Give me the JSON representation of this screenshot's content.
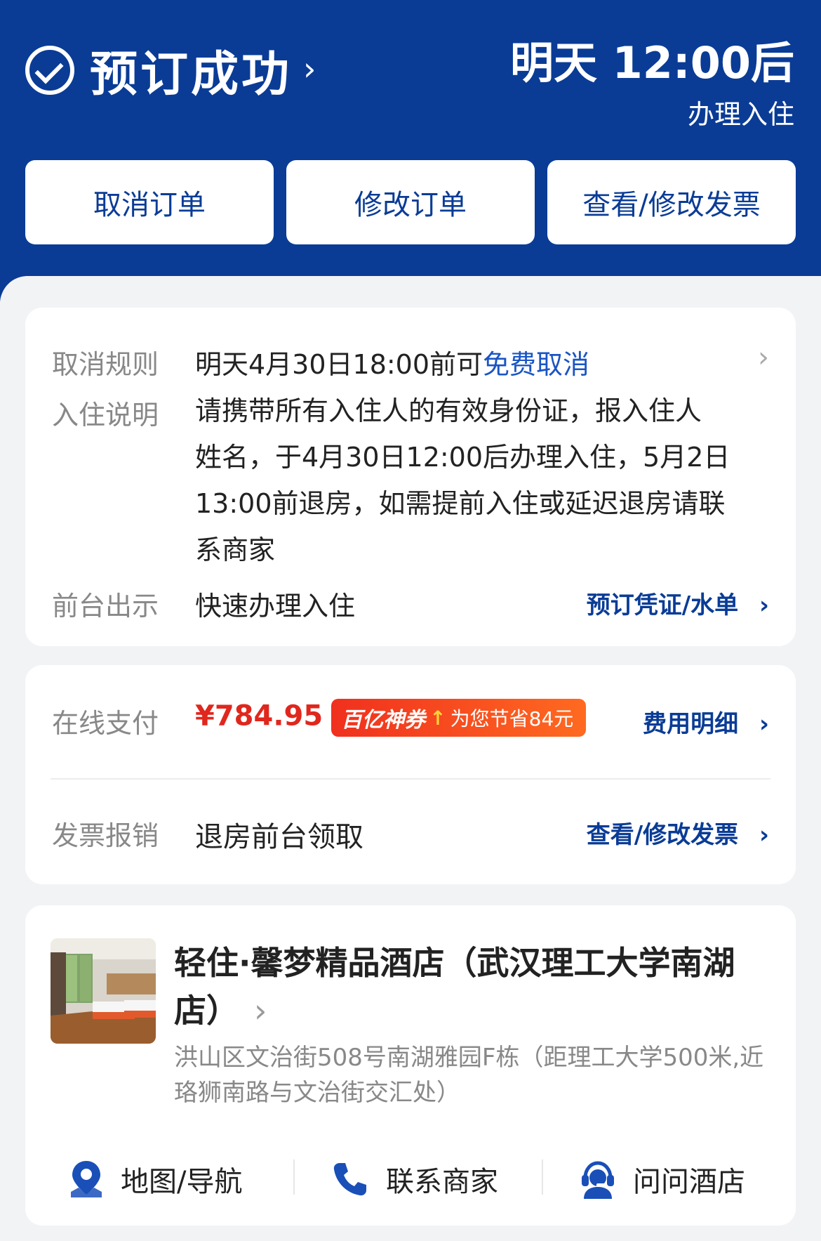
{
  "header": {
    "status_title": "预订成功",
    "checkin_time": "明天 12:00后",
    "checkin_note": "办理入住",
    "buttons": [
      "取消订单",
      "修改订单",
      "查看/修改发票"
    ]
  },
  "info": {
    "cancel_label": "取消规则",
    "cancel_prefix": "明天4月30日18:00前可",
    "cancel_free": "免费取消",
    "checkin_label": "入住说明",
    "checkin_lines": [
      "请携带所有入住人的有效身份证，报入住人",
      "姓名，于4月30日12:00后办理入住，5月2日",
      "13:00前退房，如需提前入住或延迟退房请联",
      "系商家"
    ],
    "front_label": "前台出示",
    "front_value": "快速办理入住",
    "front_link": "预订凭证/水单"
  },
  "payment": {
    "label": "在线支付",
    "price": "¥784.95",
    "coupon_brand": "百亿神券",
    "coupon_text": "为您节省84元",
    "fee_link": "费用明细",
    "invoice_label": "发票报销",
    "invoice_value": "退房前台领取",
    "invoice_link": "查看/修改发票"
  },
  "hotel": {
    "name_line1": "轻住·馨梦精品酒店（武汉理工大学南湖",
    "name_line2": "店）",
    "address_line1": "洪山区文治街508号南湖雅园F栋（距理工大学500米,近",
    "address_line2": "珞狮南路与文治街交汇处）",
    "actions": [
      "地图/导航",
      "联系商家",
      "问问酒店"
    ]
  },
  "colors": {
    "brand_blue": "#0a3c96",
    "link_blue": "#1a55c4",
    "price_red": "#e0271d",
    "coupon_orange": "#ff6a20"
  }
}
